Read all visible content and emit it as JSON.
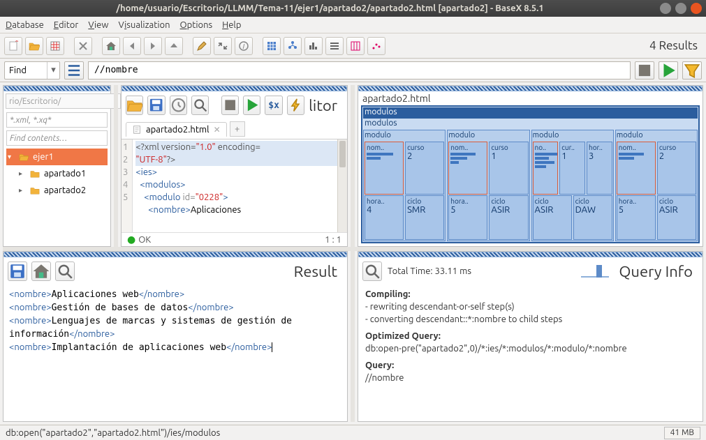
{
  "window": {
    "title": "/home/usuario/Escritorio/LLMM/Tema-11/ejer1/apartado2/apartado2.html [apartado2] - BaseX 8.5.1"
  },
  "menu": {
    "database": "Database",
    "editor": "Editor",
    "view": "View",
    "visualization": "Visualization",
    "options": "Options",
    "help": "Help"
  },
  "toolbar": {
    "results": "4 Results"
  },
  "querybar": {
    "find": "Find",
    "query": "//nombre"
  },
  "nav": {
    "breadcrumb": "rio/Escritorio/",
    "dots": "...",
    "filter_glob": "*.xml, *.xq*",
    "filter_contents": "Find contents…",
    "items": [
      {
        "name": "ejer1",
        "sel": true,
        "expand": "down"
      },
      {
        "name": "apartado1",
        "sel": false,
        "expand": "right"
      },
      {
        "name": "apartado2",
        "sel": false,
        "expand": "right"
      }
    ]
  },
  "editor": {
    "title": "litor",
    "tab": "apartado2.html",
    "dollar": "$x",
    "gutter": [
      "1",
      "2",
      "3",
      "4",
      "5"
    ],
    "line1a": "<?xml version=",
    "line1b": "\"1.0\"",
    "line1c": " encoding=",
    "line1d": "\"UTF-8\"",
    "line1e": "?>",
    "line2": "<ies>",
    "line3_indent": "  ",
    "line3": "<modulos>",
    "line4_indent": "    ",
    "line4a": "<modulo ",
    "line4b": "id=",
    "line4c": "\"0228\"",
    "line4d": ">",
    "line5_indent": "      ",
    "line5a": "<nombre>",
    "line5b": "Aplicaciones",
    "status_ok": "OK",
    "status_pos": "1 : 1"
  },
  "treemap": {
    "file": "apartado2.html",
    "root_sel": "modulos",
    "root": "modulos",
    "modulos": [
      {
        "nombre_bars": [
          38,
          20
        ],
        "curso": "2",
        "horas": "4",
        "ciclo": "SMR"
      },
      {
        "nombre_bars": [
          36,
          24,
          12
        ],
        "curso": "1",
        "horas": "5",
        "ciclo": "ASIR"
      },
      {
        "nombre_bars": [
          34,
          20,
          28,
          16
        ],
        "curso": "1",
        "horas": "3",
        "ciclo1": "ASIR",
        "ciclo2": "DAW"
      },
      {
        "nombre_bars": [
          36,
          22
        ],
        "curso": "2",
        "horas": "5",
        "ciclo": "ASIR"
      }
    ],
    "labels": {
      "modulo": "modulo",
      "nombre": "nom..",
      "curso": "curso",
      "cur": "cur..",
      "horas": "hora..",
      "hor": "hor..",
      "ciclo": "ciclo"
    }
  },
  "result": {
    "title": "Result",
    "lines": [
      {
        "open": "<nombre>",
        "text": "Aplicaciones web",
        "close": "</nombre>"
      },
      {
        "open": "<nombre>",
        "text": "Gestión de bases de datos",
        "close": "</nombre>"
      },
      {
        "open": "<nombre>",
        "text": "Lenguajes de marcas y sistemas de gestión de información",
        "close": "</nombre>"
      },
      {
        "open": "<nombre>",
        "text": "Implantación de aplicaciones web",
        "close": "</nombre>"
      }
    ]
  },
  "queryinfo": {
    "title": "Query Info",
    "time": "Total Time: 33.11 ms",
    "compiling_h": "Compiling:",
    "compiling1": "- rewriting descendant-or-self step(s)",
    "compiling2": "- converting descendant::*:nombre to child steps",
    "opt_h": "Optimized Query:",
    "opt": "db:open-pre(\"apartado2\",0)/*:ies/*:modulos/*:modulo/*:nombre",
    "query_h": "Query:",
    "query": "//nombre"
  },
  "bottombar": {
    "path": "db:open(\"apartado2\",\"apartado2.html\")/ies/modulos",
    "mem": "41 MB"
  }
}
